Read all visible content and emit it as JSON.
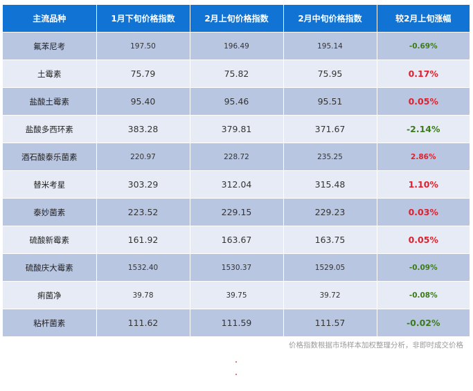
{
  "table": {
    "headers": [
      "主流品种",
      "1月下旬价格指数",
      "2月上旬价格指数",
      "2月中旬价格指数",
      "较2月上旬涨幅"
    ],
    "rows": [
      {
        "name": "氟苯尼考",
        "jan_late": "197.50",
        "feb_early": "196.49",
        "feb_mid": "195.14",
        "change": "-0.69%",
        "direction": "down",
        "size": "small"
      },
      {
        "name": "土霉素",
        "jan_late": "75.79",
        "feb_early": "75.82",
        "feb_mid": "75.95",
        "change": "0.17%",
        "direction": "up",
        "size": "big"
      },
      {
        "name": "盐酸土霉素",
        "jan_late": "95.40",
        "feb_early": "95.46",
        "feb_mid": "95.51",
        "change": "0.05%",
        "direction": "up",
        "size": "big"
      },
      {
        "name": "盐酸多西环素",
        "jan_late": "383.28",
        "feb_early": "379.81",
        "feb_mid": "371.67",
        "change": "-2.14%",
        "direction": "down",
        "size": "big"
      },
      {
        "name": "酒石酸泰乐菌素",
        "jan_late": "220.97",
        "feb_early": "228.72",
        "feb_mid": "235.25",
        "change": "2.86%",
        "direction": "up",
        "size": "small"
      },
      {
        "name": "替米考星",
        "jan_late": "303.29",
        "feb_early": "312.04",
        "feb_mid": "315.48",
        "change": "1.10%",
        "direction": "up",
        "size": "big"
      },
      {
        "name": "泰妙菌素",
        "jan_late": "223.52",
        "feb_early": "229.15",
        "feb_mid": "229.23",
        "change": "0.03%",
        "direction": "up",
        "size": "big"
      },
      {
        "name": "硫酸新霉素",
        "jan_late": "161.92",
        "feb_early": "163.67",
        "feb_mid": "163.75",
        "change": "0.05%",
        "direction": "up",
        "size": "big"
      },
      {
        "name": "硫酸庆大霉素",
        "jan_late": "1532.40",
        "feb_early": "1530.37",
        "feb_mid": "1529.05",
        "change": "-0.09%",
        "direction": "down",
        "size": "small"
      },
      {
        "name": "痢菌净",
        "jan_late": "39.78",
        "feb_early": "39.75",
        "feb_mid": "39.72",
        "change": "-0.08%",
        "direction": "down",
        "size": "small"
      },
      {
        "name": "粘杆菌素",
        "jan_late": "111.62",
        "feb_early": "111.59",
        "feb_mid": "111.57",
        "change": "-0.02%",
        "direction": "down",
        "size": "big"
      }
    ]
  },
  "footnote": "价格指数根据市场样本加权整理分析，非即时成交价格",
  "colors": {
    "header_bg": "#1173d4",
    "row_odd": "#b9c6e2",
    "row_even": "#e6ebf5",
    "negative": "#3c7a1c",
    "positive": "#e0202c"
  }
}
